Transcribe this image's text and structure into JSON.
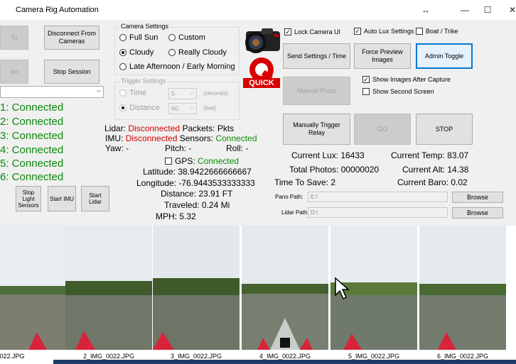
{
  "window": {
    "title": "Camera Rig Automation",
    "controls": [
      "↔",
      "—",
      "☐",
      "✕"
    ]
  },
  "left": {
    "btn_top_cut": "To",
    "disconnect_label": "Disconnect From Cameras",
    "btn_mid_cut": "ion",
    "stop_session_label": "Stop Session",
    "dropdown_value": "",
    "camera_status": [
      "1: Connected",
      "2: Connected",
      "3: Connected",
      "4: Connected",
      "5: Connected",
      "6: Connected"
    ],
    "stop_light_label": "Stop Light Sensors",
    "start_imu_label": "Start IMU",
    "start_lidar_label": "Start Lidar"
  },
  "camera_settings": {
    "title": "Camera Settings",
    "options": [
      {
        "label": "Full Sun",
        "selected": false
      },
      {
        "label": "Custom",
        "selected": false
      },
      {
        "label": "Cloudy",
        "selected": true
      },
      {
        "label": "Really Cloudy",
        "selected": false
      },
      {
        "label": "Late Afternoon / Early Morning",
        "selected": false
      }
    ]
  },
  "trigger_settings": {
    "title": "Trigger Settings",
    "time_label": "Time",
    "time_value": "5",
    "time_unit": "(seconds)",
    "distance_label": "Distance",
    "distance_value": "60",
    "distance_unit": "(feet)"
  },
  "sensors": {
    "lidar_label": "Lidar:",
    "lidar_status": "Disconnected",
    "packets_label": "Packets:",
    "packets_value": "Pkts",
    "imu_label": "IMU:",
    "imu_status": "Disconnected",
    "sensors_label": "Sensors:",
    "sensors_status": "Connected",
    "yaw_label": "Yaw:",
    "yaw_value": "-",
    "pitch_label": "Pitch:",
    "pitch_value": "-",
    "roll_label": "Roll:",
    "roll_value": "-",
    "gps_label": "GPS:",
    "gps_status": "Connected",
    "latitude": "Latitude: 38.9422666666667",
    "longitude": "Longitude: -76.9443533333333",
    "distance": "Distance: 23.91 FT",
    "traveled": "Traveled: 0.24 Mi",
    "mph": "MPH: 5.32"
  },
  "logo": {
    "letter": "Q",
    "text": "QUICK"
  },
  "right": {
    "lock_camera_label": "Lock Camera UI",
    "auto_lux_label": "Auto Lux Settings",
    "boat_trike_label": "Boat / Trike",
    "send_settings_label": "Send Settings / Time",
    "force_preview_label": "Force Preview Images",
    "admin_toggle_label": "Admin Toggle",
    "show_images_label": "Show Images After Capture",
    "show_second_label": "Show Second Screen",
    "manual_photo_label": "Manual Photo",
    "manual_relay_label": "Manually Trigger Relay",
    "go_label": "GO",
    "stop_label": "STOP",
    "current_lux": "Current Lux: 16433",
    "current_temp": "Current Temp: 83.07",
    "total_photos": "Total Photos: 00000020",
    "current_alt": "Current Alt: 14.38",
    "time_to_save": "Time To Save: 2",
    "current_baro": "Current Baro: 0.02",
    "pano_label": "Pano Path:",
    "pano_value": "E:\\",
    "lidar_path_label": "Lidar Path",
    "lidar_path_value": "D:\\",
    "browse_label": "Browse"
  },
  "thumbnails": [
    "022.JPG",
    "2_IMG_0022.JPG",
    "3_IMG_0022.JPG",
    "4_IMG_0022.JPG",
    "5_IMG_0022.JPG",
    "6_IMG_0022.JPG"
  ]
}
